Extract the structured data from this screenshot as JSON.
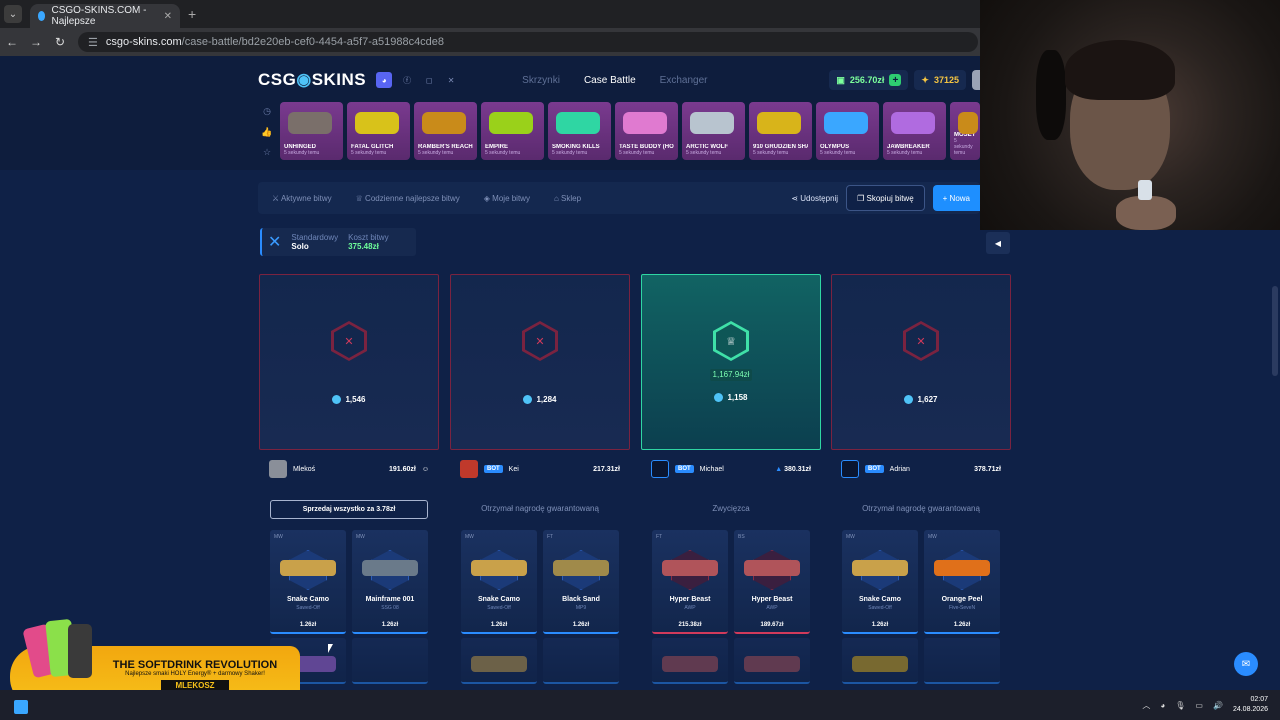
{
  "browser": {
    "tab_title": "CSGO-SKINS.COM - Najlepsze",
    "url_host": "csgo-skins.com",
    "url_path": "/case-battle/bd2e20eb-cef0-4454-a5f7-a51988c4cde8"
  },
  "header": {
    "logo_left": "CSG",
    "logo_right": "SKINS",
    "nav": [
      "Skrzynki",
      "Case Battle",
      "Exchanger"
    ],
    "balance": "256.70zł",
    "coins": "37125"
  },
  "drops": [
    {
      "name": "UNHINGED",
      "sub": "5 sekundy temu",
      "color": "#7a6f6a"
    },
    {
      "name": "FATAL GLITCH",
      "sub": "5 sekundy temu",
      "color": "#d8c21a"
    },
    {
      "name": "RAMBER'S REACH",
      "sub": "5 sekundy temu",
      "color": "#c98b1a"
    },
    {
      "name": "EMPIRE",
      "sub": "5 sekundy temu",
      "color": "#9ad11a"
    },
    {
      "name": "SMOKING KILLS",
      "sub": "5 sekundy temu",
      "color": "#2fd6a3"
    },
    {
      "name": "TASTE BUDDY (HOLO)",
      "sub": "5 sekundy temu",
      "color": "#e07ad0"
    },
    {
      "name": "ARCTIC WOLF",
      "sub": "5 sekundy temu",
      "color": "#b8c4cf"
    },
    {
      "name": "910 GRUDZIEŃ SHANGHAI 2024",
      "sub": "5 sekundy temu",
      "color": "#d8b41a"
    },
    {
      "name": "OLYMPUS",
      "sub": "5 sekundy temu",
      "color": "#3aa7ff"
    },
    {
      "name": "JAWBREAKER",
      "sub": "5 sekundy temu",
      "color": "#b06be0"
    },
    {
      "name": "MOSEYLE BUDAPES",
      "sub": "5 sekundy temu",
      "color": "#c98b1a"
    }
  ],
  "subnav": {
    "items": [
      "Aktywne bitwy",
      "Codzienne najlepsze bitwy",
      "Moje bitwy",
      "Sklep"
    ],
    "share": "Udostępnij",
    "copy": "Skopiuj bitwę",
    "new": "+ Nowa"
  },
  "mode": {
    "type": "Standardowy",
    "sub": "Solo",
    "cost_label": "Koszt bitwy",
    "cost": "375.48zł"
  },
  "columns": [
    {
      "score": "1,546",
      "player": "Mlekoś",
      "bot": "",
      "value": "191.60zł",
      "status": "",
      "sell": "Sprzedaj wszystko za 3.78zł",
      "items": [
        {
          "cond": "MW",
          "name": "Snake Camo",
          "type": "Sawed-Off",
          "price": "1.26zł",
          "color": "#c9a14a"
        },
        {
          "cond": "MW",
          "name": "Mainframe 001",
          "type": "SSG 08",
          "price": "1.26zł",
          "color": "#6a7a8a"
        }
      ]
    },
    {
      "score": "1,284",
      "player": "Kei",
      "bot": "BOT",
      "value": "217.31zł",
      "status": "Otrzymał nagrodę gwarantowaną",
      "sell": "",
      "items": [
        {
          "cond": "MW",
          "name": "Snake Camo",
          "type": "Sawed-Off",
          "price": "1.26zł",
          "color": "#c9a14a"
        },
        {
          "cond": "FT",
          "name": "Black Sand",
          "type": "MP9",
          "price": "1.26zł",
          "color": "#a08a4a"
        }
      ]
    },
    {
      "score": "1,158",
      "prize": "1,167.94zł",
      "player": "Michael",
      "bot": "BOT",
      "value": "380.31zł",
      "status": "Zwycięzca",
      "sell": "",
      "items": [
        {
          "cond": "FT",
          "name": "Hyper Beast",
          "type": "AWP",
          "price": "215.38zł",
          "color": "#b0545a"
        },
        {
          "cond": "BS",
          "name": "Hyper Beast",
          "type": "AWP",
          "price": "189.67zł",
          "color": "#b0545a"
        }
      ]
    },
    {
      "score": "1,627",
      "player": "Adrian",
      "bot": "BOT",
      "value": "378.71zł",
      "status": "Otrzymał nagrodę gwarantowaną",
      "sell": "",
      "items": [
        {
          "cond": "MW",
          "name": "Snake Camo",
          "type": "Sawed-Off",
          "price": "1.26zł",
          "color": "#c9a14a"
        },
        {
          "cond": "MW",
          "name": "Orange Peel",
          "type": "Five-SeveN",
          "price": "1.26zł",
          "color": "#e0701a"
        }
      ]
    }
  ],
  "ad": {
    "headline": "THE SOFTDRINK REVOLUTION",
    "sub": "Najlepsze smaki HOLY Energy® + darmowy Shaker!",
    "code": "MLEKOSZ",
    "fine": "10% zniżki z kodem"
  },
  "taskbar": {
    "time": "02:07",
    "date": "24.08.2026"
  }
}
